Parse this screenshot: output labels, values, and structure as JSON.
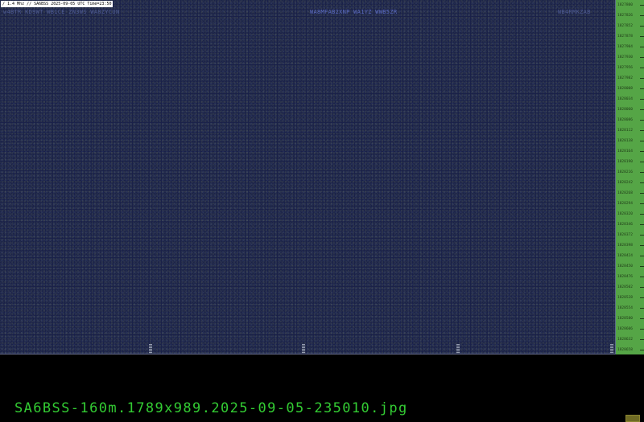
{
  "info_label": "/ 1.4 Mhz // SA6BSS 2025-09-05 UTC Time=23:50",
  "callsign_groups": [
    {
      "text": "w4BTR KD9WT   WB1CE ZN3WS  WA8ZYCUN"
    },
    {
      "text": "WA8MFAB2XNP  WA1YZ WWB5ZR"
    },
    {
      "text": "WB4RMKZAB"
    }
  ],
  "scale_labels": [
    "1827800",
    "1827826",
    "1827852",
    "1827878",
    "1827904",
    "1827930",
    "1827956",
    "1827982",
    "1828008",
    "1828034",
    "1828060",
    "1828086",
    "1828112",
    "1828138",
    "1828164",
    "1828190",
    "1828216",
    "1828242",
    "1828268",
    "1828294",
    "1828320",
    "1828346",
    "1828372",
    "1828398",
    "1828424",
    "1828450",
    "1828476",
    "1828502",
    "1828528",
    "1828554",
    "1828580",
    "1828606",
    "1828632",
    "1828658"
  ],
  "filename": "SA6BSS-160m.1789x989.2025-09-05-235010.jpg",
  "colors": {
    "waterfall": "#1a2149",
    "scale": "#55a546",
    "filename_text": "#33cc33",
    "background": "#000000"
  }
}
